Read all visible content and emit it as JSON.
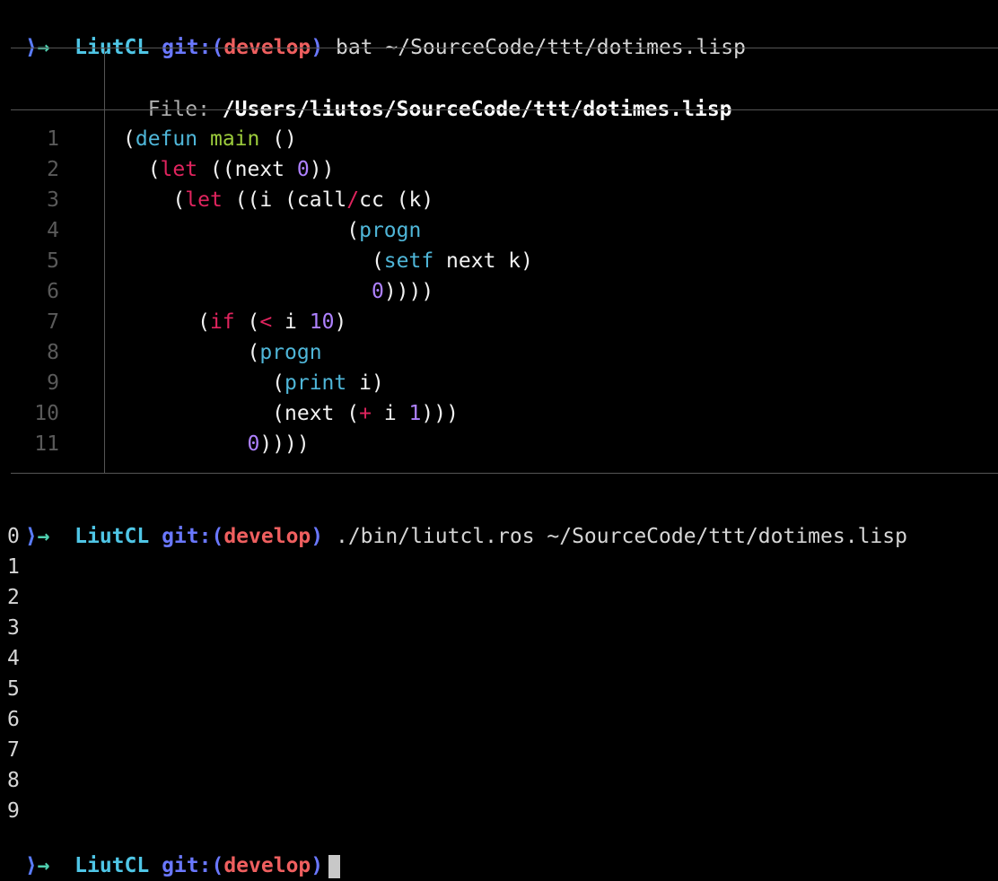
{
  "prompts": [
    {
      "arrow": "→",
      "user": "LiutCL",
      "git": "git:(",
      "branch": "develop",
      "git_close": ")",
      "command": "bat ~/SourceCode/ttt/dotimes.lisp"
    },
    {
      "arrow": "→",
      "user": "LiutCL",
      "git": "git:(",
      "branch": "develop",
      "git_close": ")",
      "command": "./bin/liutcl.ros ~/SourceCode/ttt/dotimes.lisp"
    },
    {
      "arrow": "→",
      "user": "LiutCL",
      "git": "git:(",
      "branch": "develop",
      "git_close": ")",
      "command": ""
    }
  ],
  "bat": {
    "file_label": "File: ",
    "file_path": "/Users/liutos/SourceCode/ttt/dotimes.lisp",
    "line_numbers": [
      "1",
      "2",
      "3",
      "4",
      "5",
      "6",
      "7",
      "8",
      "9",
      "10",
      "11"
    ]
  },
  "code": {
    "l1": {
      "p1": "(",
      "defun": "defun",
      "sp1": " ",
      "main": "main",
      "rest": " ()"
    },
    "l2": {
      "indent": "  (",
      "let": "let",
      "mid": " ((next ",
      "zero": "0",
      "end": "))"
    },
    "l3": {
      "indent": "    (",
      "let": "let",
      "mid": " ((i (call",
      "slash": "/",
      "end": "cc (k)"
    },
    "l4": {
      "indent": "                  (",
      "progn": "progn"
    },
    "l5": {
      "indent": "                    (",
      "setf": "setf",
      "end": " next k)"
    },
    "l6": {
      "indent": "                    ",
      "zero": "0",
      "end": "))))"
    },
    "l7": {
      "indent": "      (",
      "if": "if",
      "mid": " (",
      "lt": "<",
      "mid2": " i ",
      "ten": "10",
      "end": ")"
    },
    "l8": {
      "indent": "          (",
      "progn": "progn"
    },
    "l9": {
      "indent": "            (",
      "print": "print",
      "end": " i)"
    },
    "l10": {
      "indent": "            (next (",
      "plus": "+",
      "mid": " i ",
      "one": "1",
      "end": ")))"
    },
    "l11": {
      "indent": "          ",
      "zero": "0",
      "end": "))))"
    }
  },
  "output": [
    "0",
    "1",
    "2",
    "3",
    "4",
    "5",
    "6",
    "7",
    "8",
    "9"
  ]
}
